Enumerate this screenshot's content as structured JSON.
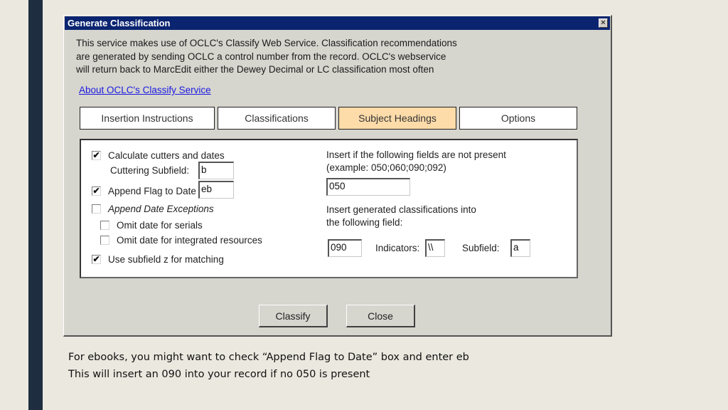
{
  "dialog": {
    "title": "Generate Classification",
    "close_glyph": "×",
    "description_lines": [
      "This service makes use of OCLC's Classify Web Service.  Classification recommendations",
      "are generated by sending OCLC a control number from the record.  OCLC's webservice",
      "will return back to MarcEdit either the Dewey Decimal or LC classification most often"
    ],
    "about_link": "About OCLC's Classify Service",
    "tabs": [
      {
        "label": "Insertion Instructions",
        "active": false
      },
      {
        "label": "Classifications",
        "active": false
      },
      {
        "label": "Subject Headings",
        "active": true
      },
      {
        "label": "Options",
        "active": false
      }
    ],
    "options": {
      "calculate_cutters": {
        "label": "Calculate cutters and dates",
        "checked": true
      },
      "cuttering_subfield": {
        "label": "Cuttering Subfield:",
        "value": "b"
      },
      "append_flag": {
        "label": "Append Flag to Date",
        "checked": true,
        "value": "eb"
      },
      "append_date_exceptions": {
        "label": "Append Date Exceptions",
        "checked": false
      },
      "omit_serials": {
        "label": "Omit date for serials",
        "checked": false
      },
      "omit_integrated": {
        "label": "Omit date for integrated resources",
        "checked": false
      },
      "use_subfield_z": {
        "label": "Use subfield z for matching",
        "checked": true
      }
    },
    "insert_if": {
      "label_line1": "Insert if the following fields are not present",
      "label_line2": "(example:  050;060;090;092)",
      "value": "050"
    },
    "insert_into": {
      "label_line1": "Insert generated classifications into",
      "label_line2": "the following field:",
      "field_value": "090",
      "indicators_label": "Indicators:",
      "indicators_value": "\\\\",
      "subfield_label": "Subfield:",
      "subfield_value": "a"
    },
    "buttons": {
      "classify": "Classify",
      "close": "Close"
    },
    "check_glyph": "✔"
  },
  "caption": {
    "line1": "For ebooks, you might want to check “Append Flag to Date” box and enter eb",
    "line2": "This will insert an 090 into your record if no 050 is present"
  }
}
